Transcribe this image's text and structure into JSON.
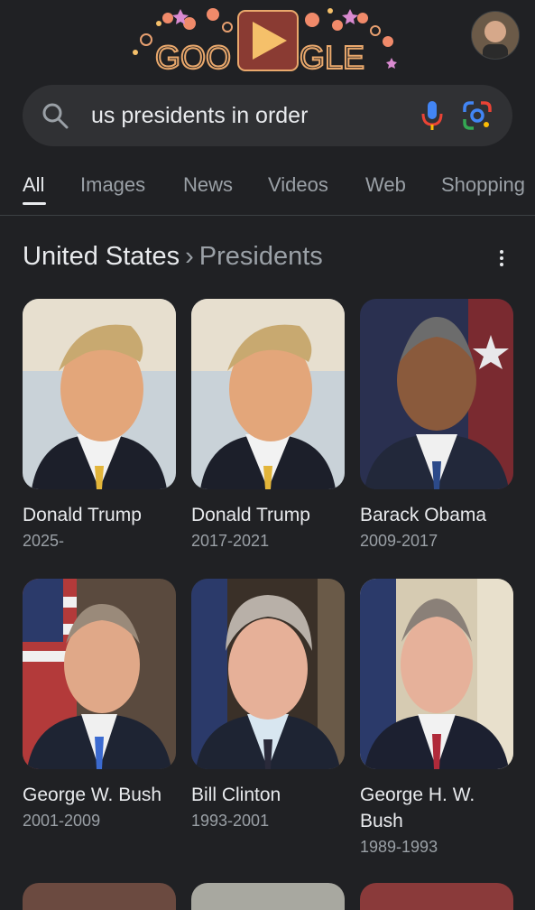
{
  "doodle": {
    "letters_left": "GOO",
    "letters_right": "GLE",
    "alt": "Google Doodle"
  },
  "search": {
    "query": "us presidents in order"
  },
  "tabs": [
    "All",
    "Images",
    "News",
    "Videos",
    "Web",
    "Shopping"
  ],
  "heading": {
    "entity": "United States",
    "separator": "›",
    "topic": "Presidents"
  },
  "presidents": [
    {
      "name": "Donald Trump",
      "years": "2025-"
    },
    {
      "name": "Donald Trump",
      "years": "2017-2021"
    },
    {
      "name": "Barack Obama",
      "years": "2009-2017"
    },
    {
      "name": "George W. Bush",
      "years": "2001-2009"
    },
    {
      "name": "Bill Clinton",
      "years": "1993-2001"
    },
    {
      "name": "George H. W. Bush",
      "years": "1989-1993"
    }
  ],
  "icons": {
    "search": "search-icon",
    "mic": "mic-icon",
    "lens": "google-lens-icon",
    "more": "more-vert-icon",
    "avatar": "account-avatar"
  },
  "colors": {
    "background": "#202124",
    "surface": "#303134",
    "text": "#e8eaed",
    "muted": "#9aa0a6"
  }
}
